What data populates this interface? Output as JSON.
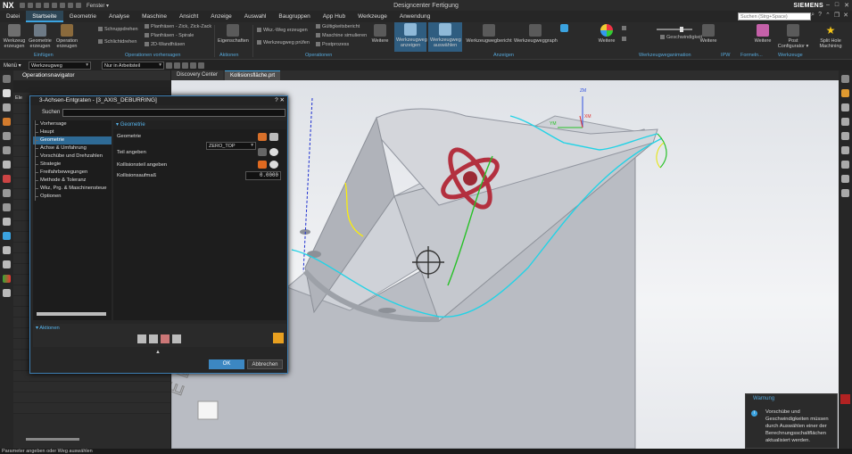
{
  "titlebar": {
    "logo": "NX",
    "window_menu": "Fenster ▾",
    "title": "Designcenter Fertigung",
    "brand": "SIEMENS"
  },
  "menubar": {
    "items": [
      "Datei",
      "Startseite",
      "Geometrie",
      "Analyse",
      "Maschine",
      "Ansicht",
      "Anzeige",
      "Auswahl",
      "Baugruppen",
      "App Hub",
      "Werkzeuge",
      "Anwendung"
    ],
    "active_index": 1,
    "search_placeholder": "Suchen (Strg+Space)"
  },
  "ribbon": {
    "buttons_left": [
      "Werkzeug erzeugen",
      "Geometrie erzeugen",
      "Operation erzeugen"
    ],
    "small_ops": [
      "Schruppdrehen",
      "Schlichtdrehen",
      "Planfräsen - Zick, Zick-Zack",
      "Planfräsen - Spirale",
      "2D-Wandfräsen"
    ],
    "eigenschaften": "Eigenschaften",
    "aktionen_items": [
      "Wkz.-Weg erzeugen",
      "Werkzeugweg prüfen"
    ],
    "ops_items": [
      "Gültigkeitsbericht",
      "Maschine simulieren",
      "Postprozess"
    ],
    "weitere": "Weitere",
    "wz_anzeigen": "Werkzeugweg anzeigen",
    "wz_auswaehlen": "Werkzeugweg auswählen",
    "wz_bericht": "Werkzeugwegbericht",
    "wz_graph": "Werkzeugweggraph",
    "geschwindigkeit": "Geschwindigkeit",
    "post_configurator": "Post Configurator ▾",
    "split_hole": "Split Hole Machining",
    "groups": [
      "Einfügen",
      "Operationen vorhersagen",
      "Aktionen",
      "Operationen",
      "Anzeigen",
      "Werkzeugweganimation",
      "IPW",
      "Formeln...",
      "Werkzeuge"
    ]
  },
  "filterbar": {
    "menu_label": "Menü ▾",
    "type_filter": "Werkzeugweg",
    "scope_filter": "Nur in Arbeitsteil"
  },
  "navigator": {
    "title": "Operationsnavigator",
    "rows_label": "Ele"
  },
  "tabs": [
    "Discovery Center",
    "Kollisionsfläche.prt"
  ],
  "viewport": {
    "triad": {
      "zm": "ZM",
      "ym": "YM",
      "xm": "XM"
    }
  },
  "dialog": {
    "title": "3-Achsen-Entgraten - [3_AXIS_DEBURRING]",
    "search_label": "Suchen",
    "tree": [
      "Vorhersage",
      "Haupt",
      "Geometrie",
      "Achse & Umfahrung",
      "Vorschübe und Drehzahlen",
      "Strategie",
      "Freifahrbewegungen",
      "Methode & Toleranz",
      "Wkz, Prg. & Maschinensteue",
      "Optionen"
    ],
    "tree_selected": 2,
    "section": "Geometrie",
    "rows": {
      "geometrie_label": "Geometrie",
      "geometrie_value": "ZERO_TOP",
      "teil_label": "Teil angeben",
      "kollision_label": "Kollisionsteil angeben",
      "aufmass_label": "Kollisionsaufmaß",
      "aufmass_value": "0.0000"
    },
    "actions_label": "Aktionen",
    "ok": "OK",
    "cancel": "Abbrechen",
    "title_buttons": "? ✕"
  },
  "warning": {
    "title": "Warnung",
    "text": "Vorschübe und Geschwindigkeiten müssen durch Auswählen einer der Berechnungsschaltflächen aktualisiert werden."
  },
  "status": "Parameter angeben oder Weg auswählen",
  "colors": {
    "accent": "#3ba3e0",
    "ok_button": "#3c87c2",
    "warning_close": "#b22222"
  }
}
